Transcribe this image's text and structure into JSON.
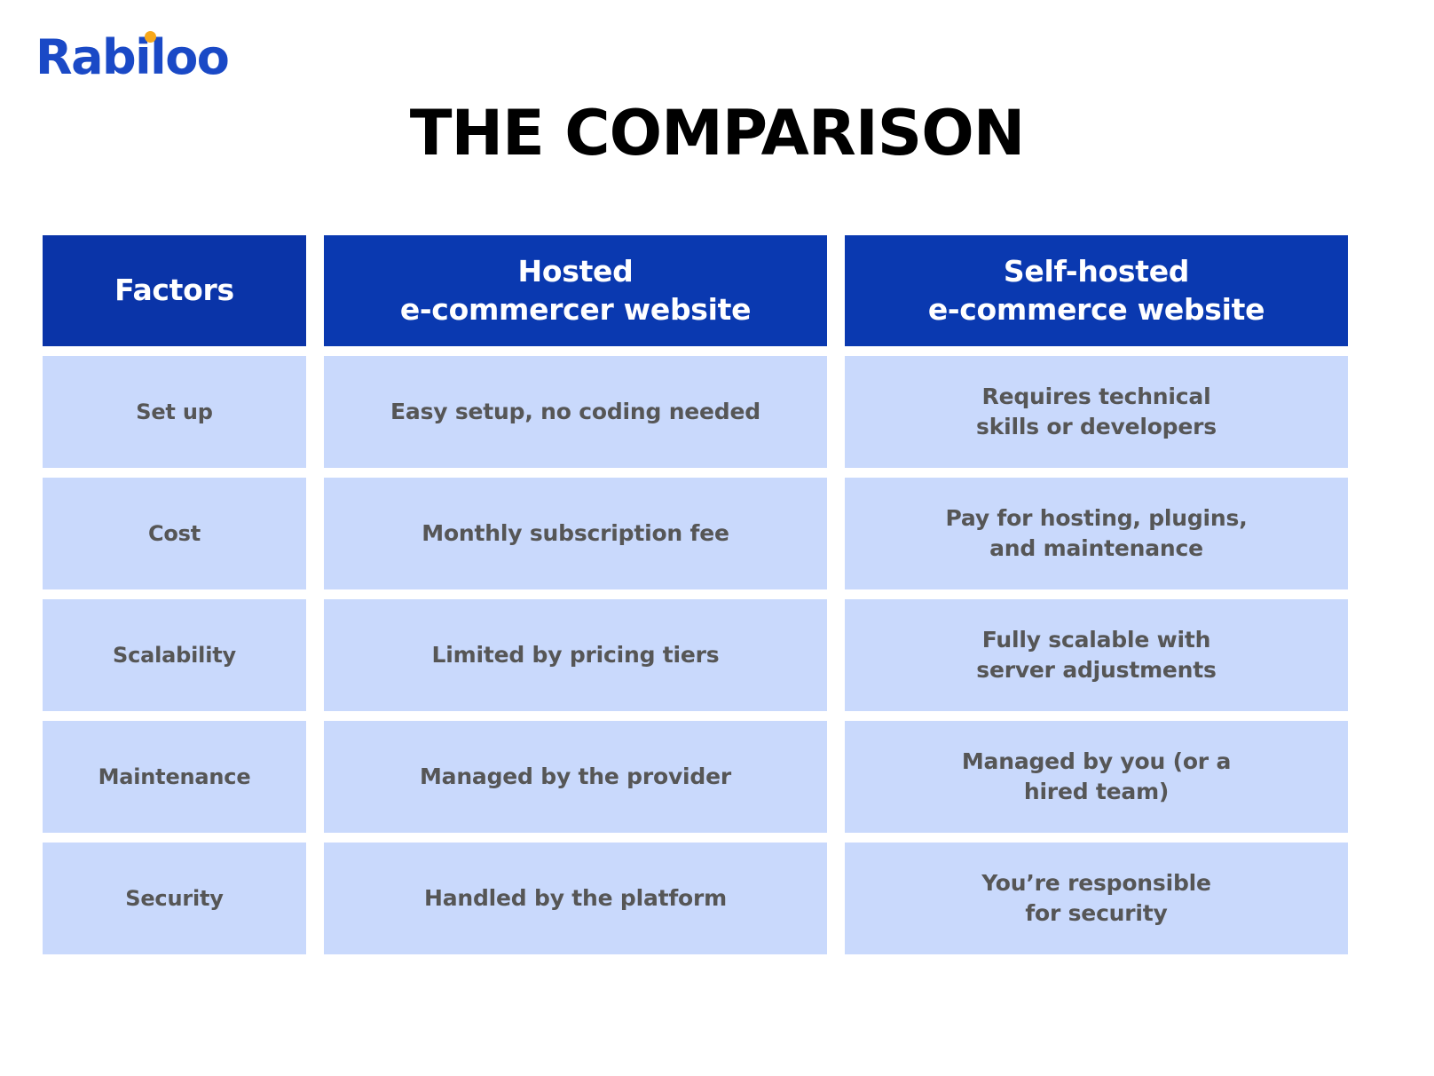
{
  "brand": {
    "name": "Rabiloo",
    "logo_color": "#1A49C6",
    "dot_color": "#F7A81B"
  },
  "title": "THE COMPARISON",
  "theme": {
    "header_bg": "#0A39B0",
    "header_first_bg": "#0A34A8",
    "cell_bg": "#C9D9FC",
    "cell_text": "#565656",
    "title_color": "#000000"
  },
  "table": {
    "headers": [
      "Factors",
      "Hosted\ne-commercer website",
      "Self-hosted\ne-commerce website"
    ],
    "rows": [
      {
        "factor": "Set up",
        "hosted": "Easy setup, no coding needed",
        "self_hosted": "Requires technical\nskills or developers"
      },
      {
        "factor": "Cost",
        "hosted": "Monthly subscription fee",
        "self_hosted": "Pay for hosting, plugins,\nand maintenance"
      },
      {
        "factor": "Scalability",
        "hosted": "Limited by pricing tiers",
        "self_hosted": "Fully scalable with\nserver adjustments"
      },
      {
        "factor": "Maintenance",
        "hosted": "Managed by the provider",
        "self_hosted": "Managed by you (or a\nhired team)"
      },
      {
        "factor": "Security",
        "hosted": "Handled by the platform",
        "self_hosted": "You’re responsible\nfor security"
      }
    ]
  }
}
